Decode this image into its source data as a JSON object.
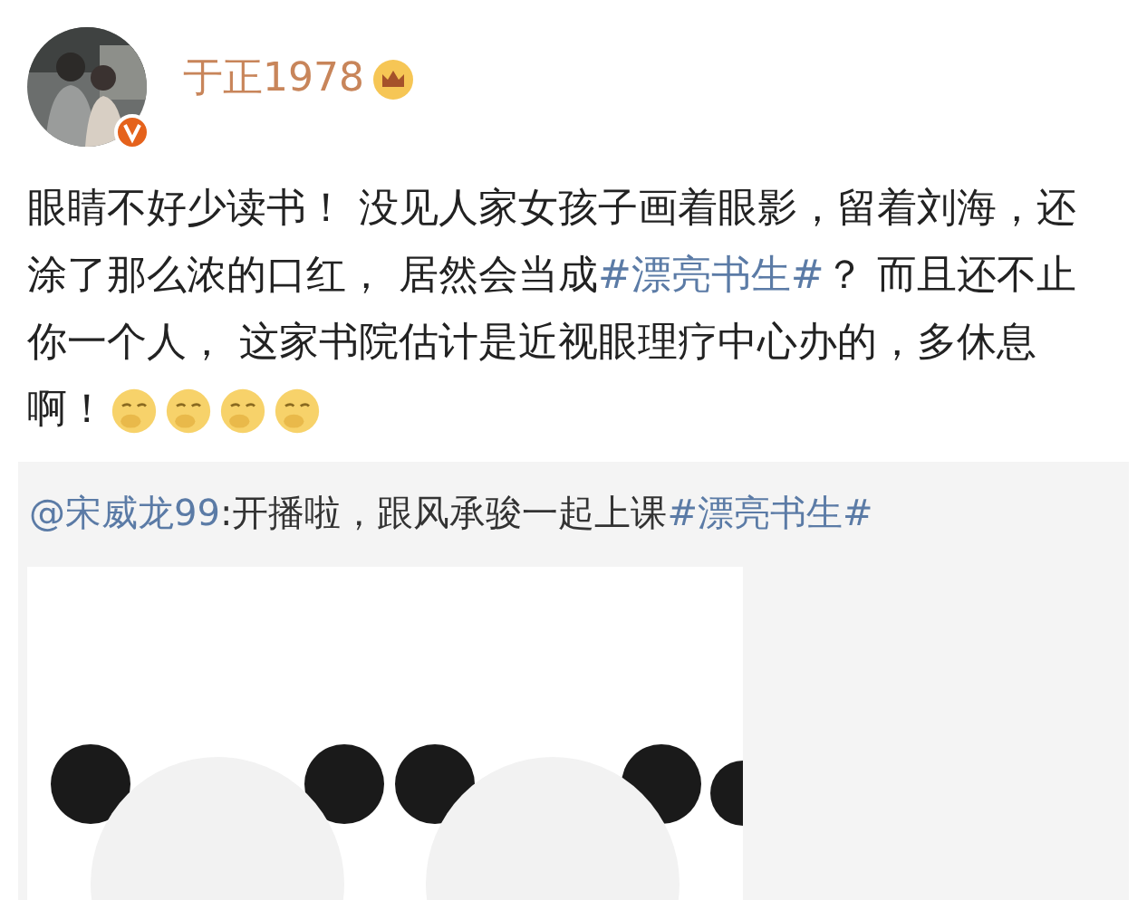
{
  "author": {
    "name": "于正1978",
    "verified": true,
    "crown": true
  },
  "post": {
    "segments": [
      {
        "kind": "text",
        "text": "眼睛不好少读书！ 没见人家女孩子画着眼影，留着刘海，还涂了那么浓的口红， 居然会当成"
      },
      {
        "kind": "topic",
        "text": "#漂亮书生#"
      },
      {
        "kind": "text",
        "text": "？ 而且还不止你一个人， 这家书院估计是近视眼理疗中心办的，多休息啊！"
      },
      {
        "kind": "emoji"
      },
      {
        "kind": "emoji"
      },
      {
        "kind": "emoji"
      },
      {
        "kind": "emoji"
      }
    ]
  },
  "repost": {
    "segments": [
      {
        "kind": "mention",
        "text": "@宋威龙99"
      },
      {
        "kind": "text",
        "text": ":开播啦，跟风承骏一起上课"
      },
      {
        "kind": "topic",
        "text": "#漂亮书生#"
      }
    ]
  }
}
